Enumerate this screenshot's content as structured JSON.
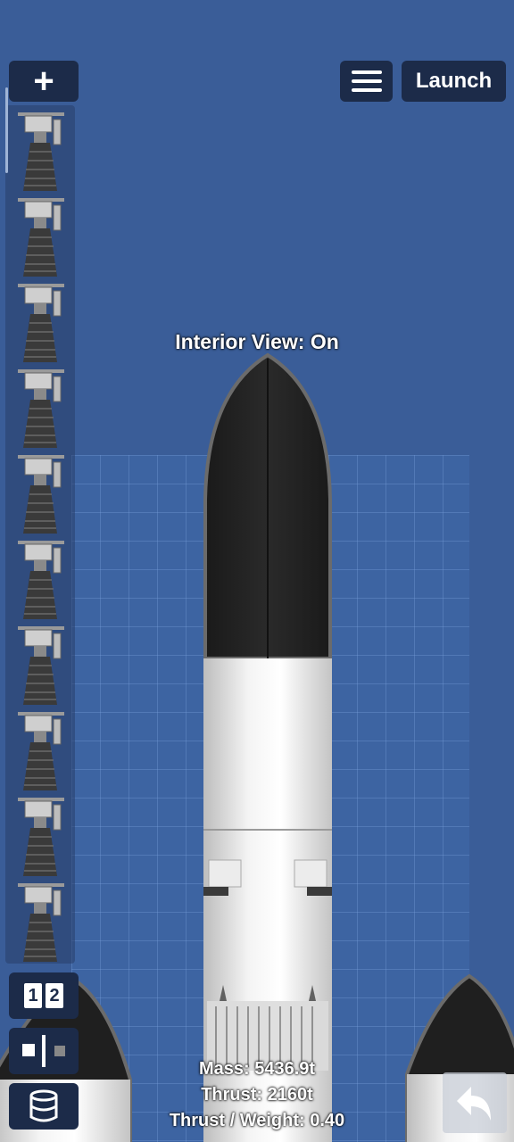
{
  "toolbar": {
    "add_label": "+",
    "launch_label": "Launch"
  },
  "canvas": {
    "interior_view_label": "Interior View: On"
  },
  "parts_panel": {
    "items": [
      "engine",
      "engine",
      "engine",
      "engine",
      "engine",
      "engine",
      "engine",
      "engine",
      "engine",
      "engine"
    ]
  },
  "bottom_tools": {
    "stage_digit_1": "1",
    "stage_digit_2": "2"
  },
  "stats": {
    "mass": "Mass: 5436.9t",
    "thrust": "Thrust: 2160t",
    "twr": "Thrust / Weight: 0.40"
  },
  "colors": {
    "background": "#3a5d98",
    "grid": "#3d64a2",
    "button": "#1c2b49"
  }
}
